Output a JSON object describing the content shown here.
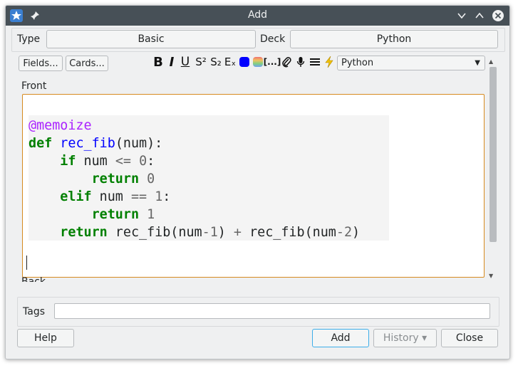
{
  "window": {
    "title": "Add"
  },
  "header": {
    "type_label": "Type",
    "type_value": "Basic",
    "deck_label": "Deck",
    "deck_value": "Python"
  },
  "toolbar": {
    "fields_label": "Fields...",
    "cards_label": "Cards...",
    "format_buttons": {
      "bold": "B",
      "italic": "I",
      "underline": "U",
      "superscript": "S²",
      "subscript": "S₂",
      "clear_format": "Eₓ",
      "cloze": "[...]"
    },
    "text_color": "#0000ff",
    "language_value": "Python"
  },
  "fields": {
    "front_label": "Front",
    "back_label": "Back",
    "code_lines": [
      "@memoize",
      "def rec_fib(num):",
      "    if num <= 0:",
      "        return 0",
      "    elif num == 1:",
      "        return 1",
      "    return rec_fib(num-1) + rec_fib(num-2)"
    ]
  },
  "tags": {
    "label": "Tags",
    "value": ""
  },
  "footer": {
    "help_label": "Help",
    "add_label": "Add",
    "history_label": "History ▾",
    "close_label": "Close"
  },
  "colors": {
    "titlebar": "#475057",
    "editor_border": "#d68a1f",
    "keyword": "#008000",
    "function": "#0000ff",
    "decorator": "#aa22ff",
    "number": "#666666"
  }
}
